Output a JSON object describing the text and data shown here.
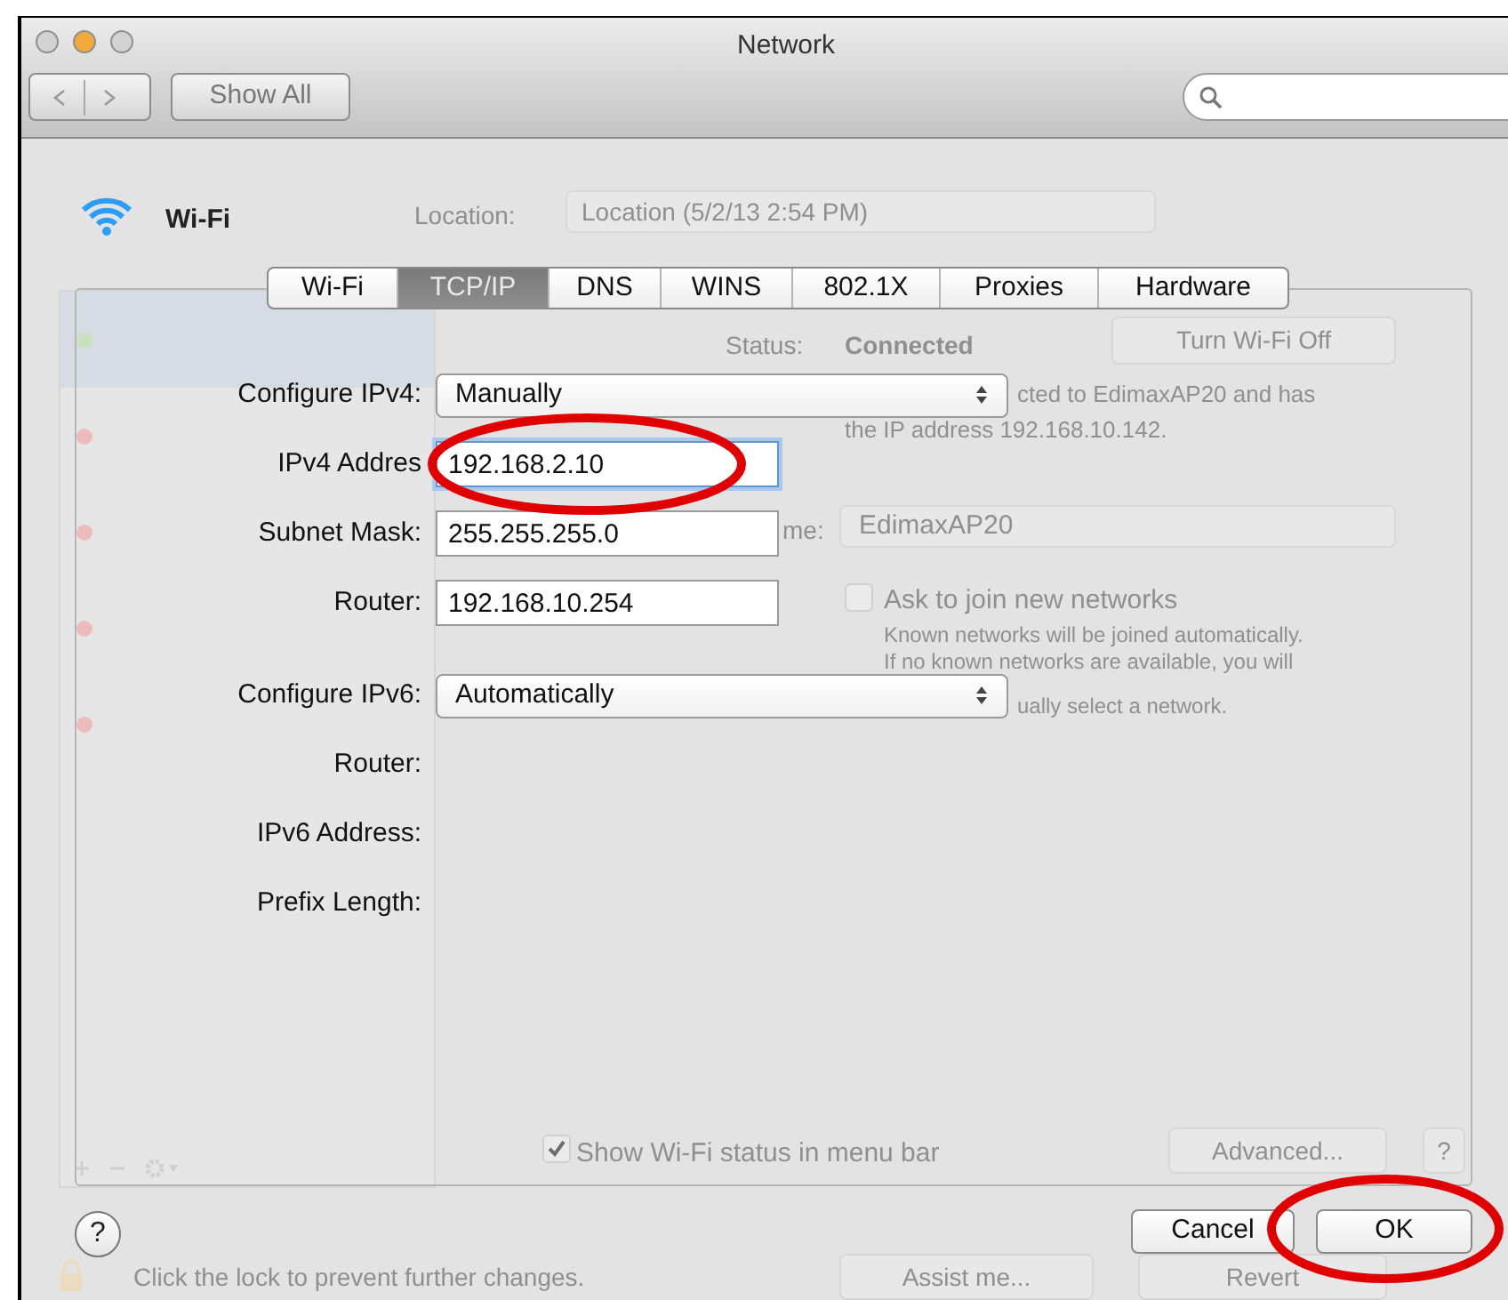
{
  "window": {
    "title": "Network"
  },
  "traffic_lights": [
    {
      "color": "#d2d2d2"
    },
    {
      "color": "#f2a93b"
    },
    {
      "color": "#d2d2d2"
    }
  ],
  "toolbar": {
    "show_all": "Show All"
  },
  "header": {
    "service": "Wi-Fi",
    "location_label": "Location:",
    "location_value": "Location (5/2/13 2:54 PM)"
  },
  "sidebar": {
    "items": [
      {
        "color": "#c6e2bc",
        "selected": true
      },
      {
        "color": "#ecbcbc",
        "selected": false
      },
      {
        "color": "#ecbcbc",
        "selected": false
      },
      {
        "color": "#ecbcbc",
        "selected": false
      },
      {
        "color": "#ecbcbc",
        "selected": false
      }
    ]
  },
  "status": {
    "label": "Status:",
    "value": "Connected",
    "button": "Turn Wi-Fi Off",
    "description_lines": [
      "cted to EdimaxAP20 and has",
      "the IP address 192.168.10.142."
    ]
  },
  "network_name": {
    "label": "me:",
    "value": "EdimaxAP20"
  },
  "ask_to_join": {
    "label": "Ask to join new networks",
    "checked": false,
    "description_lines": [
      "Known networks will be joined automatically.",
      "If no known networks are available, you will",
      "ually select a network."
    ]
  },
  "show_status": {
    "label": "Show Wi-Fi status in menu bar",
    "checked": true
  },
  "advanced_button": "Advanced...",
  "help_button": "?",
  "lock_text": "Click the lock to prevent further changes.",
  "footer_buttons": [
    "Assist me...",
    "Revert"
  ],
  "sheet": {
    "tabs": [
      {
        "label": "Wi-Fi",
        "selected": false
      },
      {
        "label": "TCP/IP",
        "selected": true
      },
      {
        "label": "DNS",
        "selected": false
      },
      {
        "label": "WINS",
        "selected": false
      },
      {
        "label": "802.1X",
        "selected": false
      },
      {
        "label": "Proxies",
        "selected": false
      },
      {
        "label": "Hardware",
        "selected": false
      }
    ],
    "fields": [
      {
        "kind": "popup",
        "label": "Configure IPv4:",
        "value": "Manually"
      },
      {
        "kind": "text",
        "label": "IPv4 Addres",
        "value": "192.168.2.10",
        "focused": true
      },
      {
        "kind": "text",
        "label": "Subnet Mask:",
        "value": "255.255.255.0",
        "focused": false
      },
      {
        "kind": "text",
        "label": "Router:",
        "value": "192.168.10.254",
        "focused": false
      },
      {
        "kind": "popup",
        "label": "Configure IPv6:",
        "value": "Automatically"
      },
      {
        "kind": "static",
        "label": "Router:"
      },
      {
        "kind": "static",
        "label": "IPv6 Address:"
      },
      {
        "kind": "static",
        "label": "Prefix Length:"
      }
    ],
    "help": "?",
    "buttons": [
      "Cancel",
      "OK"
    ]
  },
  "annotations": [
    {
      "kind": "ellipse"
    },
    {
      "kind": "ellipse"
    }
  ]
}
